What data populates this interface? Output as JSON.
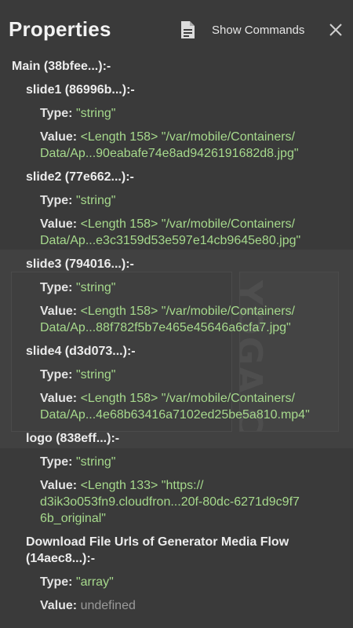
{
  "header": {
    "title": "Properties",
    "show_commands_label": "Show Commands",
    "doc_icon": "document-icon",
    "close_icon": "close-icon"
  },
  "tree": {
    "main_label": "Main (38bfee...):-",
    "slides": [
      {
        "label": "slide1 (86996b...):-",
        "type_key": "Type:",
        "type_val": "\"string\"",
        "value_key": "Value:",
        "value_line1": "<Length 158> \"/var/mobile/Containers/",
        "value_line2": "Data/Ap...90eabafe74e8ad9426191682d8.jpg\""
      },
      {
        "label": "slide2 (77e662...):-",
        "type_key": "Type:",
        "type_val": "\"string\"",
        "value_key": "Value:",
        "value_line1": "<Length 158> \"/var/mobile/Containers/",
        "value_line2": "Data/Ap...e3c3159d53e597e14cb9645e80.jpg\""
      },
      {
        "label": "slide3 (794016...):-",
        "type_key": "Type:",
        "type_val": "\"string\"",
        "value_key": "Value:",
        "value_line1": "<Length 158> \"/var/mobile/Containers/",
        "value_line2": "Data/Ap...88f782f5b7e465e45646a6cfa7.jpg\""
      },
      {
        "label": "slide4 (d3d073...):-",
        "type_key": "Type:",
        "type_val": "\"string\"",
        "value_key": "Value:",
        "value_line1": "<Length 158> \"/var/mobile/Containers/",
        "value_line2": "Data/Ap...4e68b63416a7102ed25be5a810.mp4\""
      }
    ],
    "logo": {
      "label": "logo (838eff...):-",
      "type_key": "Type:",
      "type_val": "\"string\"",
      "value_key": "Value:",
      "value_line1": "<Length 133> \"https://",
      "value_line2": "d3ik3o053fn9.cloudfron...20f-80dc-6271d9c9f7",
      "value_line3": "6b_original\""
    },
    "download": {
      "label_line1": "Download File Urls of Generator Media Flow",
      "label_line2": "(14aec8...):-",
      "type_key": "Type:",
      "type_val": "\"array\"",
      "value_key": "Value:",
      "value_val": "undefined"
    }
  },
  "colors": {
    "background": "#3a3a3a",
    "string_value": "#a6d98c",
    "undefined_value": "#9a9a9a"
  }
}
